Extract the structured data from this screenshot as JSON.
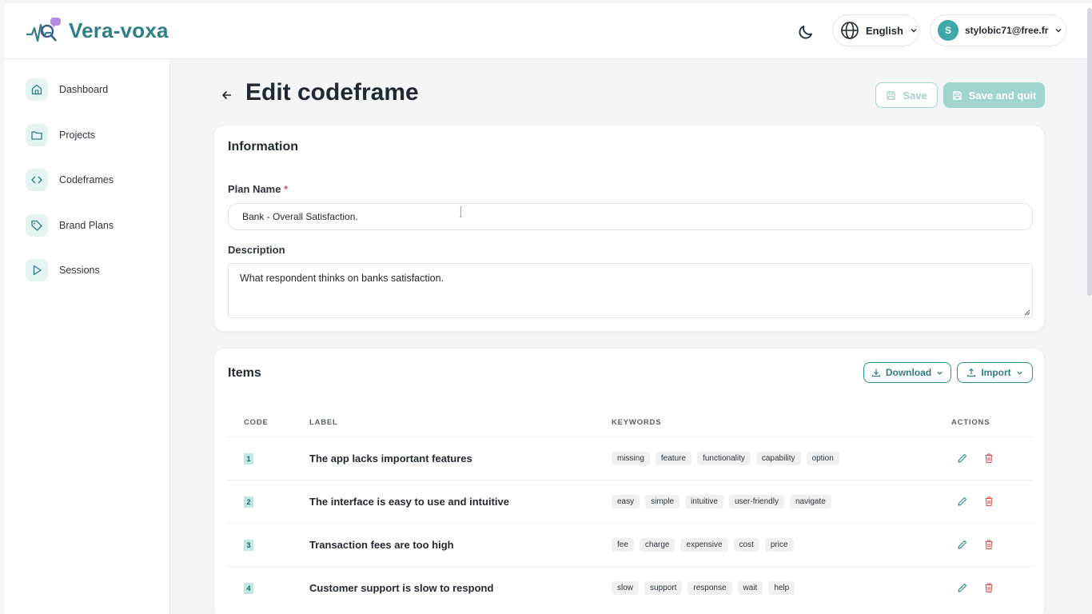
{
  "app": {
    "name": "Vera-voxa"
  },
  "header": {
    "language": "English",
    "user_initial": "S",
    "user_email": "stylobic71@free.fr"
  },
  "sidebar": {
    "items": [
      {
        "label": "Dashboard",
        "icon": "home-icon"
      },
      {
        "label": "Projects",
        "icon": "folder-icon"
      },
      {
        "label": "Codeframes",
        "icon": "code-icon"
      },
      {
        "label": "Brand Plans",
        "icon": "tag-icon"
      },
      {
        "label": "Sessions",
        "icon": "play-icon"
      }
    ]
  },
  "page": {
    "title": "Edit codeframe",
    "save_label": "Save",
    "save_quit_label": "Save and quit"
  },
  "information": {
    "title": "Information",
    "plan_name_label": "Plan Name",
    "required_mark": "*",
    "plan_name_value": "Bank - Overall Satisfaction.",
    "description_label": "Description",
    "description_value": "What respondent thinks on banks satisfaction."
  },
  "items": {
    "title": "Items",
    "download_label": "Download",
    "import_label": "Import",
    "columns": {
      "code": "CODE",
      "label": "LABEL",
      "keywords": "KEYWORDS",
      "actions": "ACTIONS"
    },
    "rows": [
      {
        "code": "1",
        "label": "The app lacks important features",
        "keywords": [
          "missing",
          "feature",
          "functionality",
          "capability",
          "option"
        ]
      },
      {
        "code": "2",
        "label": "The interface is easy to use and intuitive",
        "keywords": [
          "easy",
          "simple",
          "intuitive",
          "user-friendly",
          "navigate"
        ]
      },
      {
        "code": "3",
        "label": "Transaction fees are too high",
        "keywords": [
          "fee",
          "charge",
          "expensive",
          "cost",
          "price"
        ]
      },
      {
        "code": "4",
        "label": "Customer support is slow to respond",
        "keywords": [
          "slow",
          "support",
          "response",
          "wait",
          "help"
        ]
      }
    ]
  },
  "colors": {
    "brand": "#2f7f86",
    "accent_light": "#9fd4cf",
    "danger": "#d9534f",
    "badge_bg": "#bfe8e3"
  }
}
